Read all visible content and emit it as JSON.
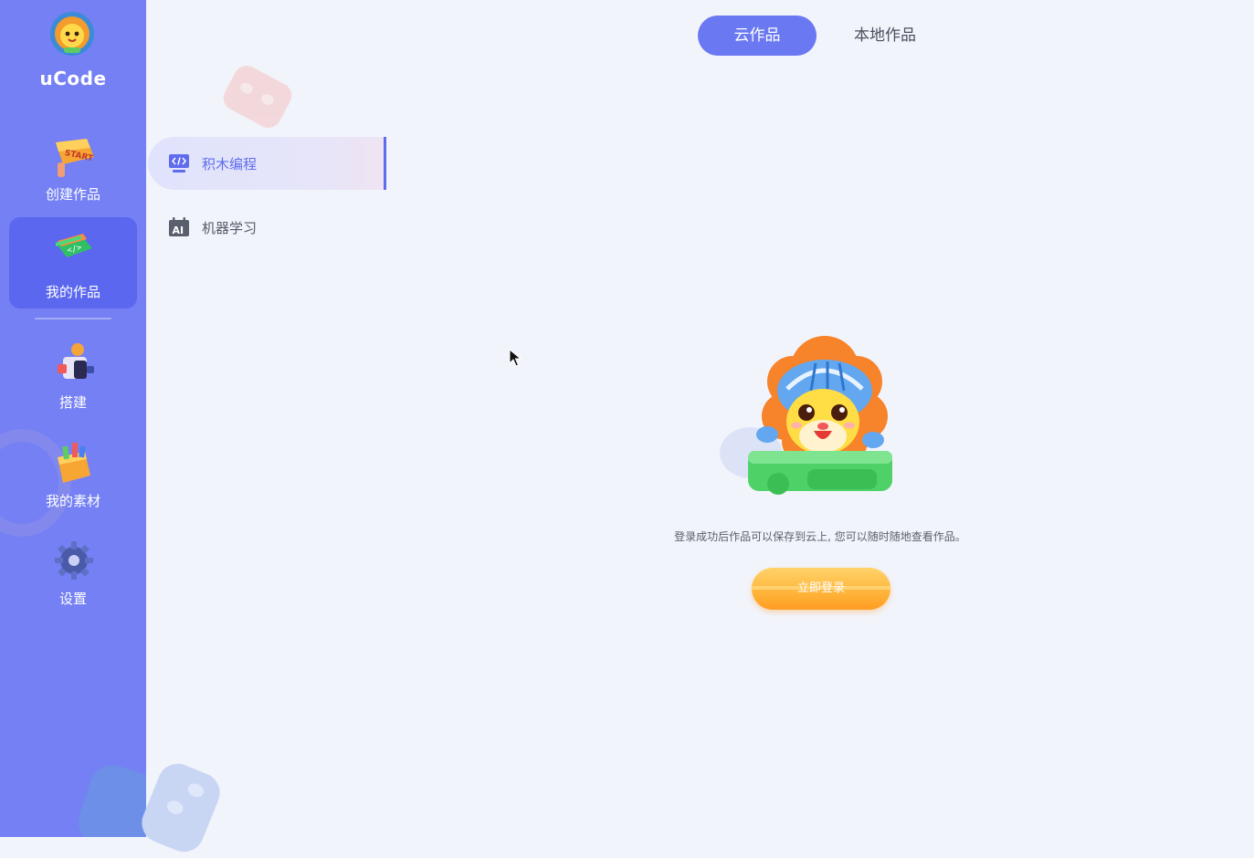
{
  "app": {
    "name": "uCode"
  },
  "sidebar": {
    "items": [
      {
        "label": "创建作品",
        "icon": "start-sign-icon",
        "active": false
      },
      {
        "label": "我的作品",
        "icon": "folder-code-icon",
        "active": true
      },
      {
        "label": "搭建",
        "icon": "robot-build-icon",
        "active": false
      },
      {
        "label": "我的素材",
        "icon": "material-box-icon",
        "active": false
      },
      {
        "label": "设置",
        "icon": "gear-icon",
        "active": false
      }
    ]
  },
  "tabs": [
    {
      "label": "云作品",
      "active": true
    },
    {
      "label": "本地作品",
      "active": false
    }
  ],
  "submenu": [
    {
      "label": "积木编程",
      "icon": "code-screen-icon",
      "active": true
    },
    {
      "label": "机器学习",
      "icon": "ai-calendar-icon",
      "active": false
    }
  ],
  "empty_state": {
    "message": "登录成功后作品可以保存到云上, 您可以随时随地查看作品。",
    "button_label": "立即登录"
  },
  "colors": {
    "sidebar": "#7480f3",
    "sidebar_active": "#5a67ee",
    "accent": "#6a78f1",
    "button": "#ffb43a",
    "background": "#f2f4fb"
  }
}
